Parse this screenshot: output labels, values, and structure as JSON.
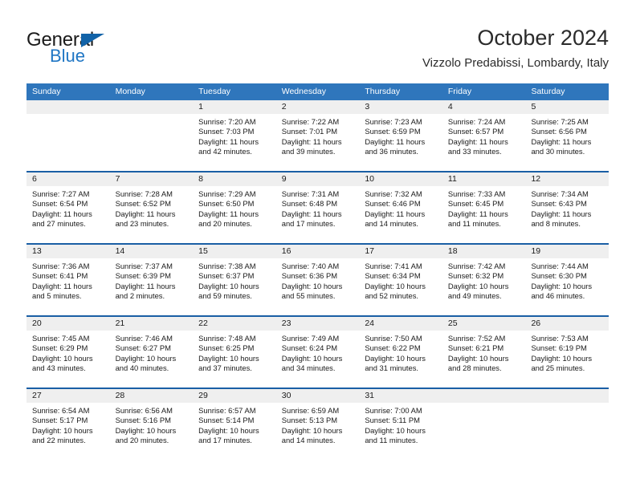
{
  "brand": {
    "name_part1": "General",
    "name_part2": "Blue",
    "triangle_color": "#1263a8",
    "blue_color": "#1f76c4"
  },
  "header": {
    "month_title": "October 2024",
    "location": "Vizzolo Predabissi, Lombardy, Italy"
  },
  "theme": {
    "header_blue": "#2f76bc",
    "row_divider_blue": "#1a5fa5",
    "day_number_band": "#efefef",
    "text": "#1a1a1a"
  },
  "weekdays": [
    "Sunday",
    "Monday",
    "Tuesday",
    "Wednesday",
    "Thursday",
    "Friday",
    "Saturday"
  ],
  "labels": {
    "sunrise_prefix": "Sunrise: ",
    "sunset_prefix": "Sunset: ",
    "daylight_prefix": "Daylight: "
  },
  "weeks": [
    [
      {
        "day": "",
        "sunrise": "",
        "sunset": "",
        "daylight": ""
      },
      {
        "day": "",
        "sunrise": "",
        "sunset": "",
        "daylight": ""
      },
      {
        "day": "1",
        "sunrise": "Sunrise: 7:20 AM",
        "sunset": "Sunset: 7:03 PM",
        "daylight": "Daylight: 11 hours and 42 minutes."
      },
      {
        "day": "2",
        "sunrise": "Sunrise: 7:22 AM",
        "sunset": "Sunset: 7:01 PM",
        "daylight": "Daylight: 11 hours and 39 minutes."
      },
      {
        "day": "3",
        "sunrise": "Sunrise: 7:23 AM",
        "sunset": "Sunset: 6:59 PM",
        "daylight": "Daylight: 11 hours and 36 minutes."
      },
      {
        "day": "4",
        "sunrise": "Sunrise: 7:24 AM",
        "sunset": "Sunset: 6:57 PM",
        "daylight": "Daylight: 11 hours and 33 minutes."
      },
      {
        "day": "5",
        "sunrise": "Sunrise: 7:25 AM",
        "sunset": "Sunset: 6:56 PM",
        "daylight": "Daylight: 11 hours and 30 minutes."
      }
    ],
    [
      {
        "day": "6",
        "sunrise": "Sunrise: 7:27 AM",
        "sunset": "Sunset: 6:54 PM",
        "daylight": "Daylight: 11 hours and 27 minutes."
      },
      {
        "day": "7",
        "sunrise": "Sunrise: 7:28 AM",
        "sunset": "Sunset: 6:52 PM",
        "daylight": "Daylight: 11 hours and 23 minutes."
      },
      {
        "day": "8",
        "sunrise": "Sunrise: 7:29 AM",
        "sunset": "Sunset: 6:50 PM",
        "daylight": "Daylight: 11 hours and 20 minutes."
      },
      {
        "day": "9",
        "sunrise": "Sunrise: 7:31 AM",
        "sunset": "Sunset: 6:48 PM",
        "daylight": "Daylight: 11 hours and 17 minutes."
      },
      {
        "day": "10",
        "sunrise": "Sunrise: 7:32 AM",
        "sunset": "Sunset: 6:46 PM",
        "daylight": "Daylight: 11 hours and 14 minutes."
      },
      {
        "day": "11",
        "sunrise": "Sunrise: 7:33 AM",
        "sunset": "Sunset: 6:45 PM",
        "daylight": "Daylight: 11 hours and 11 minutes."
      },
      {
        "day": "12",
        "sunrise": "Sunrise: 7:34 AM",
        "sunset": "Sunset: 6:43 PM",
        "daylight": "Daylight: 11 hours and 8 minutes."
      }
    ],
    [
      {
        "day": "13",
        "sunrise": "Sunrise: 7:36 AM",
        "sunset": "Sunset: 6:41 PM",
        "daylight": "Daylight: 11 hours and 5 minutes."
      },
      {
        "day": "14",
        "sunrise": "Sunrise: 7:37 AM",
        "sunset": "Sunset: 6:39 PM",
        "daylight": "Daylight: 11 hours and 2 minutes."
      },
      {
        "day": "15",
        "sunrise": "Sunrise: 7:38 AM",
        "sunset": "Sunset: 6:37 PM",
        "daylight": "Daylight: 10 hours and 59 minutes."
      },
      {
        "day": "16",
        "sunrise": "Sunrise: 7:40 AM",
        "sunset": "Sunset: 6:36 PM",
        "daylight": "Daylight: 10 hours and 55 minutes."
      },
      {
        "day": "17",
        "sunrise": "Sunrise: 7:41 AM",
        "sunset": "Sunset: 6:34 PM",
        "daylight": "Daylight: 10 hours and 52 minutes."
      },
      {
        "day": "18",
        "sunrise": "Sunrise: 7:42 AM",
        "sunset": "Sunset: 6:32 PM",
        "daylight": "Daylight: 10 hours and 49 minutes."
      },
      {
        "day": "19",
        "sunrise": "Sunrise: 7:44 AM",
        "sunset": "Sunset: 6:30 PM",
        "daylight": "Daylight: 10 hours and 46 minutes."
      }
    ],
    [
      {
        "day": "20",
        "sunrise": "Sunrise: 7:45 AM",
        "sunset": "Sunset: 6:29 PM",
        "daylight": "Daylight: 10 hours and 43 minutes."
      },
      {
        "day": "21",
        "sunrise": "Sunrise: 7:46 AM",
        "sunset": "Sunset: 6:27 PM",
        "daylight": "Daylight: 10 hours and 40 minutes."
      },
      {
        "day": "22",
        "sunrise": "Sunrise: 7:48 AM",
        "sunset": "Sunset: 6:25 PM",
        "daylight": "Daylight: 10 hours and 37 minutes."
      },
      {
        "day": "23",
        "sunrise": "Sunrise: 7:49 AM",
        "sunset": "Sunset: 6:24 PM",
        "daylight": "Daylight: 10 hours and 34 minutes."
      },
      {
        "day": "24",
        "sunrise": "Sunrise: 7:50 AM",
        "sunset": "Sunset: 6:22 PM",
        "daylight": "Daylight: 10 hours and 31 minutes."
      },
      {
        "day": "25",
        "sunrise": "Sunrise: 7:52 AM",
        "sunset": "Sunset: 6:21 PM",
        "daylight": "Daylight: 10 hours and 28 minutes."
      },
      {
        "day": "26",
        "sunrise": "Sunrise: 7:53 AM",
        "sunset": "Sunset: 6:19 PM",
        "daylight": "Daylight: 10 hours and 25 minutes."
      }
    ],
    [
      {
        "day": "27",
        "sunrise": "Sunrise: 6:54 AM",
        "sunset": "Sunset: 5:17 PM",
        "daylight": "Daylight: 10 hours and 22 minutes."
      },
      {
        "day": "28",
        "sunrise": "Sunrise: 6:56 AM",
        "sunset": "Sunset: 5:16 PM",
        "daylight": "Daylight: 10 hours and 20 minutes."
      },
      {
        "day": "29",
        "sunrise": "Sunrise: 6:57 AM",
        "sunset": "Sunset: 5:14 PM",
        "daylight": "Daylight: 10 hours and 17 minutes."
      },
      {
        "day": "30",
        "sunrise": "Sunrise: 6:59 AM",
        "sunset": "Sunset: 5:13 PM",
        "daylight": "Daylight: 10 hours and 14 minutes."
      },
      {
        "day": "31",
        "sunrise": "Sunrise: 7:00 AM",
        "sunset": "Sunset: 5:11 PM",
        "daylight": "Daylight: 10 hours and 11 minutes."
      },
      {
        "day": "",
        "sunrise": "",
        "sunset": "",
        "daylight": ""
      },
      {
        "day": "",
        "sunrise": "",
        "sunset": "",
        "daylight": ""
      }
    ]
  ]
}
